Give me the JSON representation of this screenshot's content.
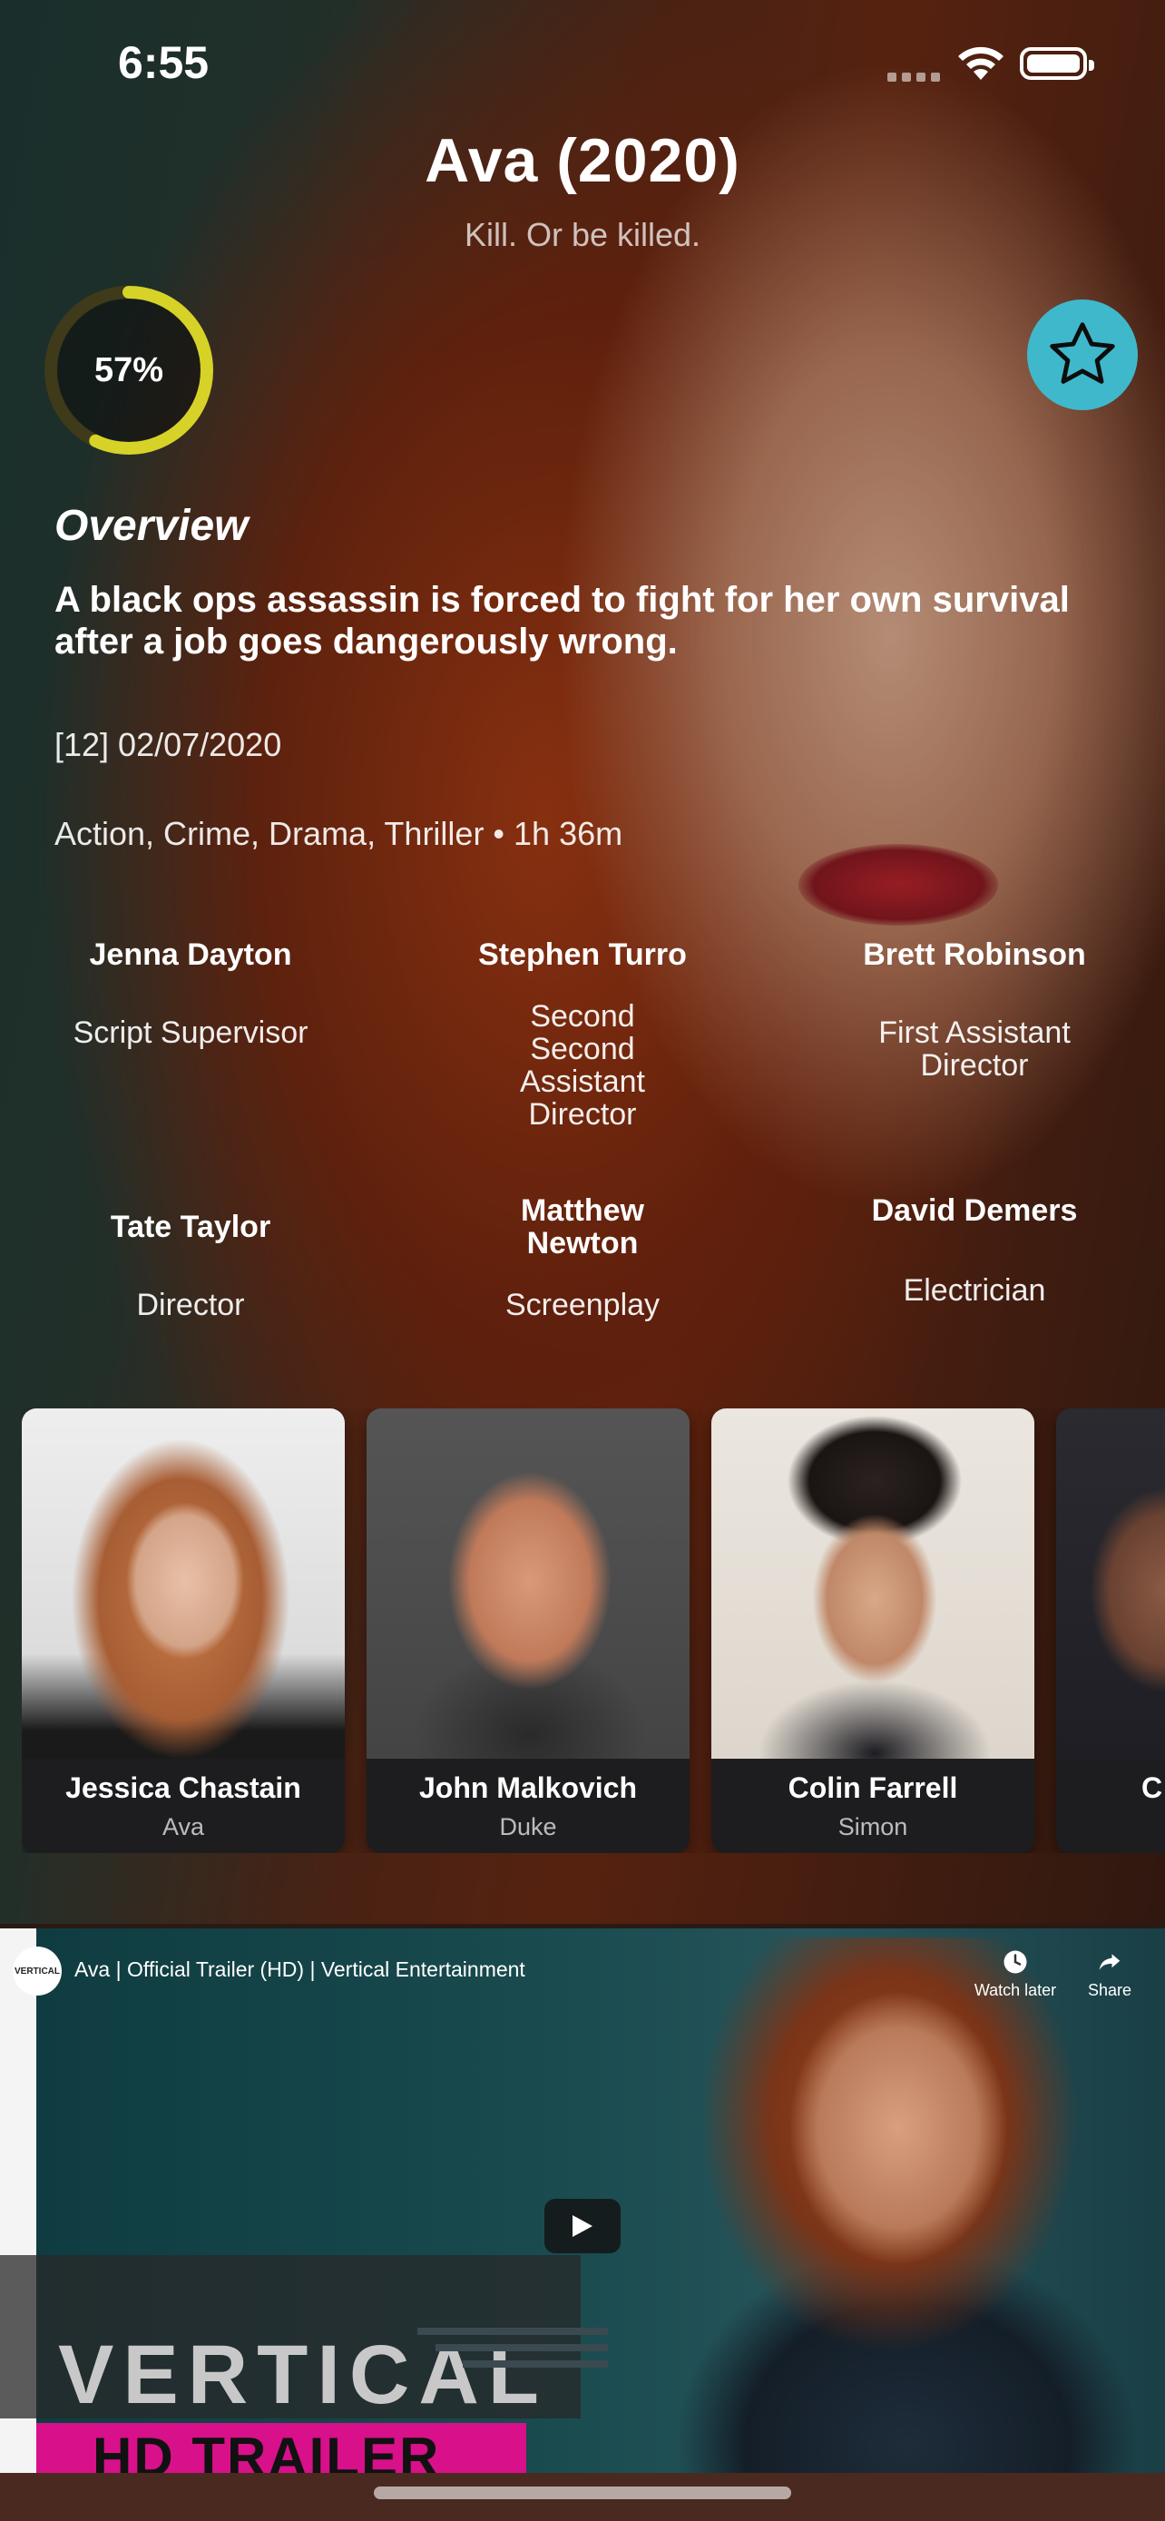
{
  "status_bar": {
    "time": "6:55"
  },
  "movie": {
    "title": "Ava (2020)",
    "tagline": "Kill. Or be killed.",
    "score_label": "57%",
    "score_fraction": 0.57,
    "overview_heading": "Overview",
    "overview": "A black ops assassin is forced to fight for her own survival after a job goes dangerously wrong.",
    "release": "[12] 02/07/2020",
    "genres_runtime": "Action, Crime, Drama, Thriller • 1h 36m",
    "favorite_icon": "star-icon"
  },
  "colors": {
    "score_ring": "#d6d228",
    "score_track": "#3e3a1a",
    "favorite_bg": "#3fb8cc",
    "hd_band": "#d8108a"
  },
  "crew": [
    {
      "name": "Jenna Dayton",
      "job": "Script Supervisor"
    },
    {
      "name": "Stephen Turro",
      "job": "Second Second Assistant Director"
    },
    {
      "name": "Brett Robinson",
      "job": "First Assistant Director"
    },
    {
      "name": "Tate Taylor",
      "job": "Director"
    },
    {
      "name": "Matthew Newton",
      "job": "Screenplay"
    },
    {
      "name": "David Demers",
      "job": "Electrician"
    }
  ],
  "cast": [
    {
      "name": "Jessica Chastain",
      "character": "Ava"
    },
    {
      "name": "John Malkovich",
      "character": "Duke"
    },
    {
      "name": "Colin Farrell",
      "character": "Simon"
    },
    {
      "name": "C",
      "character": ""
    }
  ],
  "video": {
    "channel_logo_text": "VERTICAL",
    "title": "Ava | Official Trailer (HD) | Vertical Entertainment",
    "watch_later": "Watch later",
    "share": "Share",
    "brand": "VERTICAL",
    "hd_label": "HD TRAILER"
  }
}
